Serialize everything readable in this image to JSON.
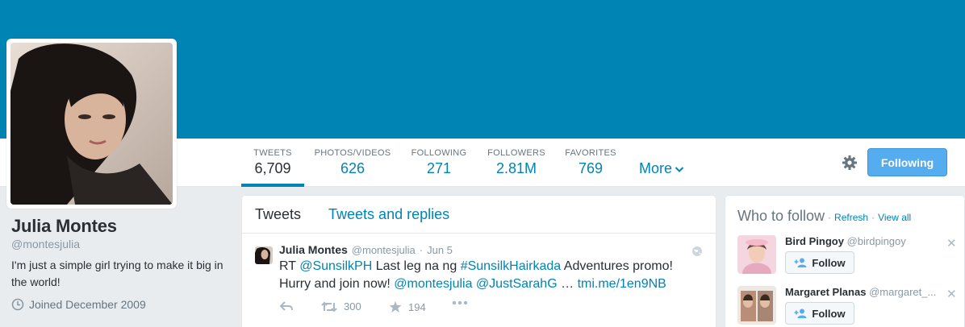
{
  "profile": {
    "name": "Julia Montes",
    "handle": "@montesjulia",
    "bio": "I'm just a simple girl trying to make it big in the world!",
    "joined": "Joined December 2009"
  },
  "stats": [
    {
      "label": "TWEETS",
      "value": "6,709",
      "active": true
    },
    {
      "label": "PHOTOS/VIDEOS",
      "value": "626"
    },
    {
      "label": "FOLLOWING",
      "value": "271"
    },
    {
      "label": "FOLLOWERS",
      "value": "2.81M"
    },
    {
      "label": "FAVORITES",
      "value": "769"
    }
  ],
  "nav": {
    "more_label": "More",
    "following_button": "Following"
  },
  "tabs": {
    "tweets": "Tweets",
    "tweets_replies": "Tweets and replies"
  },
  "tweet": {
    "name": "Julia Montes",
    "handle": "@montesjulia",
    "sep": "·",
    "date": "Jun 5",
    "rt": "RT",
    "mention1": "@SunsilkPH",
    "text1": "Last leg na ng",
    "hashtag": "#SunsilkHairkada",
    "text2": "Adventures promo!",
    "text3": "Hurry and join now!",
    "mention2": "@montesjulia",
    "mention3": "@JustSarahG",
    "ellipsis": "…",
    "link": "tmi.me/1en9NB",
    "retweets": "300",
    "favorites": "194"
  },
  "who_to_follow": {
    "title": "Who to follow",
    "dot": "·",
    "refresh": "Refresh",
    "view_all": "View all",
    "suggestions": [
      {
        "name": "Bird Pingoy",
        "handle": "@birdpingoy",
        "follow": "Follow"
      },
      {
        "name": "Margaret Planas",
        "handle": "@margaret_...",
        "follow": "Follow"
      }
    ]
  },
  "colors": {
    "banner": "#0084b4",
    "link": "#0084b4",
    "button": "#55acee"
  },
  "icons": [
    "clock-icon",
    "chevron-down-icon",
    "gear-icon",
    "globe-icon",
    "reply-icon",
    "retweet-icon",
    "star-icon",
    "more-dots-icon",
    "add-user-icon",
    "close-icon"
  ]
}
